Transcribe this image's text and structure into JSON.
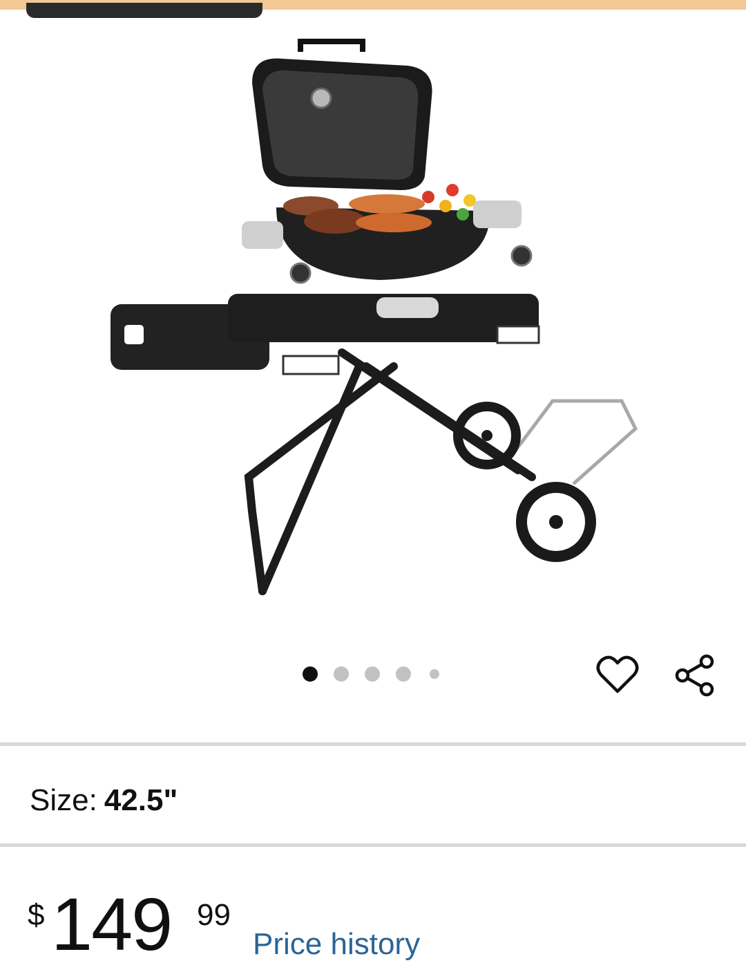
{
  "product": {
    "image_alt": "Portable gas grill on folding wheeled cart",
    "image_count": 5,
    "active_image": 1
  },
  "actions": {
    "wishlist_icon": "heart-icon",
    "share_icon": "share-icon"
  },
  "size": {
    "label": "Size:",
    "value": "42.5\""
  },
  "price": {
    "currency": "$",
    "whole": "149",
    "fraction": "99"
  },
  "price_history": {
    "label": "Price history"
  },
  "colors": {
    "link": "#2a6496",
    "divider": "#d5d9d9",
    "dot_active": "#0f1111",
    "dot_inactive": "#c2c2c2"
  }
}
